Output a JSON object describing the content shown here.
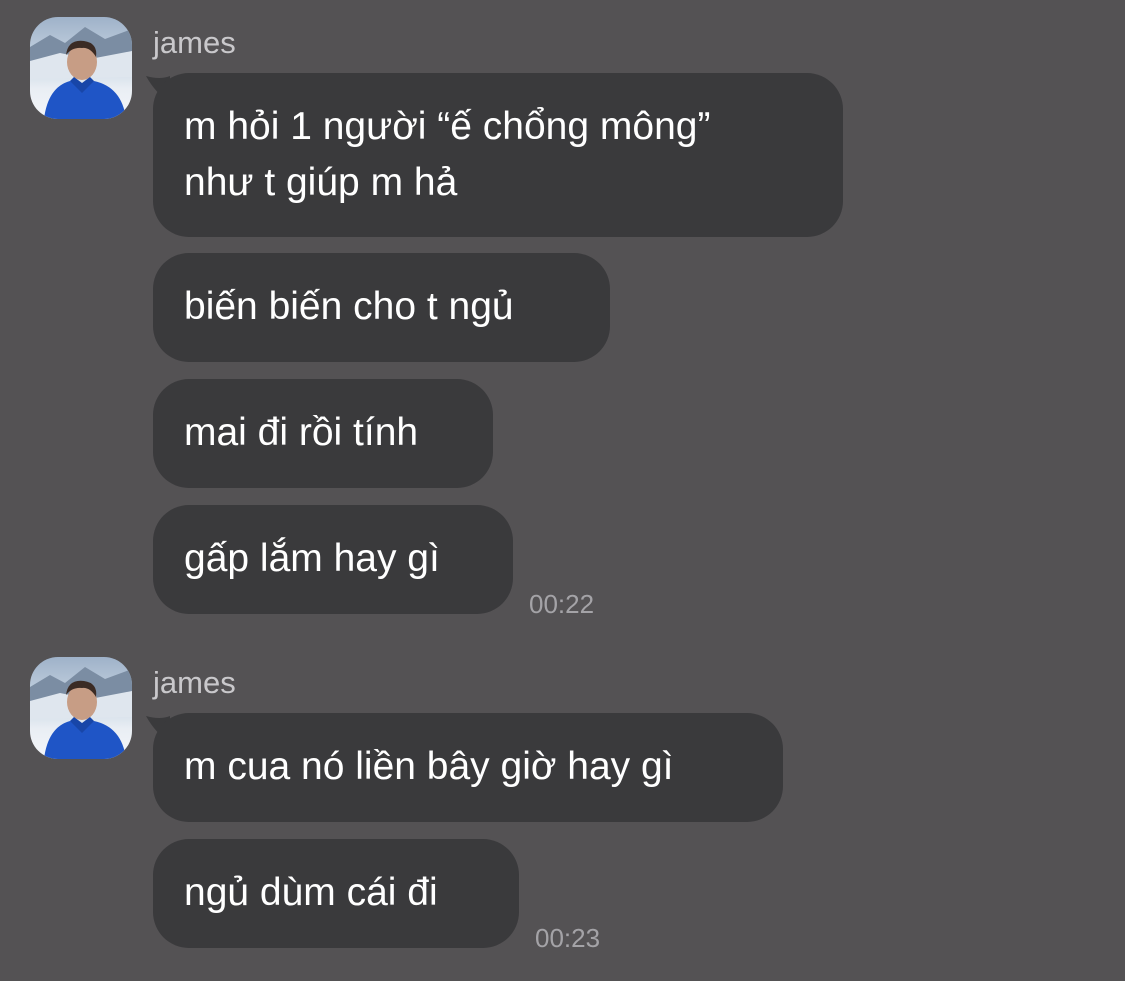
{
  "groups": [
    {
      "sender": "james",
      "messages": [
        {
          "lines": [
            "m hỏi 1 người “ế chổng mông”",
            "như t giúp m hả"
          ]
        },
        {
          "lines": [
            "biến biến cho t ngủ"
          ]
        },
        {
          "lines": [
            "mai đi rồi tính"
          ]
        },
        {
          "lines": [
            "gấp lắm hay gì"
          ]
        }
      ],
      "timestamp": "00:22"
    },
    {
      "sender": "james",
      "messages": [
        {
          "lines": [
            "m cua nó liền bây giờ hay gì"
          ]
        },
        {
          "lines": [
            "ngủ dùm cái đi"
          ]
        }
      ],
      "timestamp": "00:23"
    }
  ],
  "colors": {
    "background": "#545254",
    "bubble": "#3a3a3c",
    "bubble_text": "#ffffff",
    "sender_name": "#c9c8cb",
    "timestamp": "#a4a3a7"
  },
  "icons": {
    "avatar": "user-avatar-photo"
  }
}
